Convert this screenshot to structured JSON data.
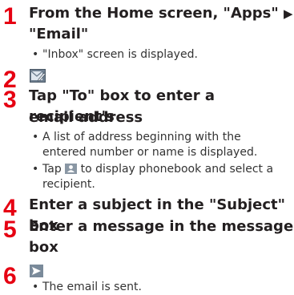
{
  "steps": [
    {
      "number": "1",
      "title_line1_prefix": "From the Home screen, \"Apps\"",
      "title_arrow": "▶",
      "title_line2": "\"Email\"",
      "bullets": [
        {
          "dot": "•",
          "text": "\"Inbox\" screen is displayed."
        }
      ]
    },
    {
      "number": "2",
      "icon": "compose-email-icon"
    },
    {
      "number": "3",
      "title_line1": "Tap \"To\" box to enter a recipient's",
      "title_line2": "email address",
      "bullets": [
        {
          "dot": "•",
          "line1": "A list of address beginning with the",
          "line2": "entered number or name is displayed."
        },
        {
          "dot": "•",
          "line1_prefix": "Tap",
          "icon": "contacts-icon",
          "line1_suffix": "to display phonebook and select a",
          "line2": "recipient."
        }
      ]
    },
    {
      "number": "4",
      "title_line1": "Enter a subject in the \"Subject\" box"
    },
    {
      "number": "5",
      "title_line1": "Enter a message in the message",
      "title_line2": "box"
    },
    {
      "number": "6",
      "icon": "send-icon",
      "bullets": [
        {
          "dot": "•",
          "text": "The email is sent."
        }
      ]
    }
  ],
  "colors": {
    "step_number": "#e60012",
    "text": "#231f20",
    "icon_fill": "#7a8a9a"
  }
}
